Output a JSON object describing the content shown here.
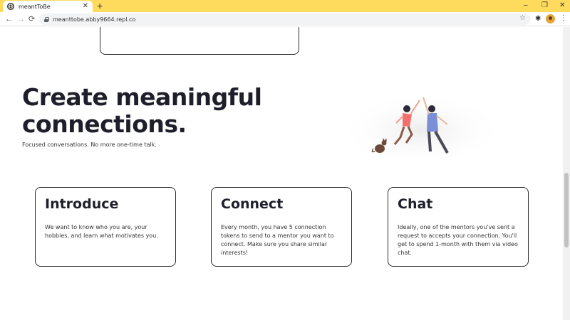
{
  "browser": {
    "tab_title": "meantToBe",
    "tab_close": "✕",
    "new_tab": "+",
    "url": "meanttobe.abby9664.repl.co",
    "controls": {
      "minimize": "–",
      "restore": "❐",
      "close": "✕"
    },
    "nav": {
      "back": "←",
      "forward": "→",
      "reload": "⟳"
    },
    "star": "☆",
    "extensions": "✱",
    "menu": "⋮"
  },
  "hero": {
    "headline": "Create meaningful connections.",
    "subline": "Focused conversations. No more one-time talk."
  },
  "features": [
    {
      "title": "Introduce",
      "text": "We want to know who you are, your hobbies, and learn what motivates you."
    },
    {
      "title": "Connect",
      "text": "Every month, you have 5 connection tokens to send to a mentor you want to connect. Make sure you share similar interests!"
    },
    {
      "title": "Chat",
      "text": "Ideally, one of the mentors you've sent a request to accepts your connection. You'll get to spend 1-month with them via video chat."
    }
  ]
}
